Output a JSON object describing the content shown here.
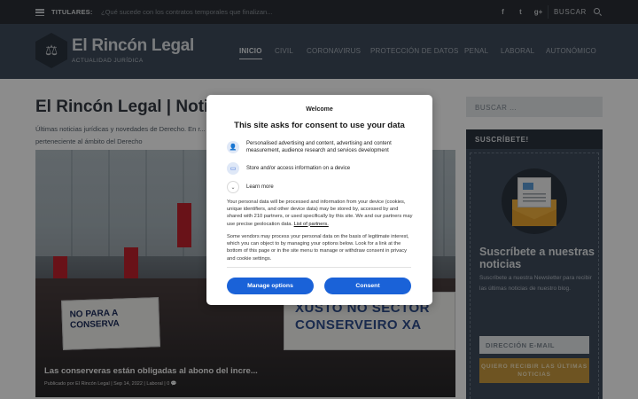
{
  "topbar": {
    "titulares_label": "TITULARES:",
    "ticker_text": "¿Qué sucede con los contratos temporales que finalizan...",
    "social": [
      "f",
      "t",
      "g+"
    ],
    "search_label": "BUSCAR"
  },
  "header": {
    "logo_title": "El Rincón Legal",
    "logo_subtitle": "ACTUALIDAD JURÍDICA",
    "nav": [
      "INICIO",
      "CIVIL",
      "CORONAVIRUS",
      "PROTECCIÓN DE DATOS",
      "PENAL",
      "LABORAL",
      "AUTONÓMICO"
    ]
  },
  "main": {
    "page_title": "El Rincón Legal | Noticia",
    "description": "Últimas noticias jurídicas y novedades de Derecho. En r... jurisprudencia perteneciente al ámbito del Derecho",
    "hero": {
      "banner_left": "NO PARA A CONSERVA",
      "banner_right": "XUSTO NO SECTOR CONSERVEIRO XA",
      "caption": "Las conserveras están obligadas al abono del incre...",
      "meta": "Publicado por El Rincón Legal | Sep 14, 2022 | Laboral | 0"
    }
  },
  "sidebar": {
    "search_placeholder": "BUSCAR ...",
    "subscribe_header": "SUSCRÍBETE!",
    "subscribe_title": "Suscríbete a nuestras noticias",
    "subscribe_text": "Suscríbete a nuestra Newsletter para recibir las últimas noticias de nuestro blog.",
    "email_placeholder": "DIRECCIÓN E-MAIL",
    "subscribe_button": "QUIERO RECIBIR LAS ÚLTIMAS NOTICIAS"
  },
  "consent": {
    "brand": "Welcome",
    "heading": "This site asks for consent to use your data",
    "purposes": [
      "Personalised advertising and content, advertising and content measurement, audience research and services development",
      "Store and/or access information on a device"
    ],
    "learn_more": "Learn more",
    "para1": "Your personal data will be processed and information from your device (cookies, unique identifiers, and other device data) may be stored by, accessed by and shared with 210 partners, or used specifically by this site. We and our partners may use precise geolocation data.",
    "partners_link": "List of partners.",
    "para2": "Some vendors may process your personal data on the basis of legitimate interest, which you can object to by managing your options below. Look for a link at the bottom of this page or in the site menu to manage or withdraw consent in privacy and cookie settings.",
    "manage_button": "Manage options",
    "consent_button": "Consent"
  },
  "colors": {
    "topbar_bg": "#2a2f35",
    "header_bg": "#3e4b5c",
    "consent_blue": "#1a62d8",
    "subscribe_button": "#c89a3e"
  },
  "icons": [
    "menu-icon",
    "facebook-icon",
    "twitter-icon",
    "google-plus-icon",
    "search-icon",
    "scales-icon",
    "envelope-icon",
    "user-icon",
    "device-icon",
    "chevron-down-icon",
    "comment-icon"
  ]
}
